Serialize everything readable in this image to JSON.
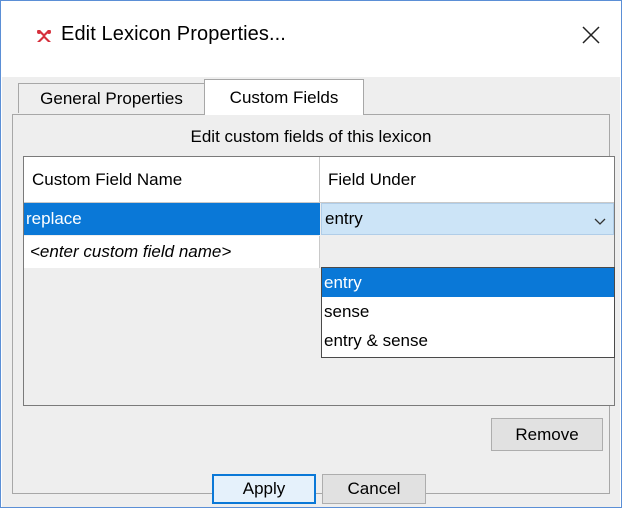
{
  "window": {
    "title": "Edit Lexicon Properties...",
    "app_icon": "lexicon-app-icon",
    "close_icon": "close-icon"
  },
  "tabs": [
    {
      "label": "General Properties",
      "active": false
    },
    {
      "label": "Custom Fields",
      "active": true
    }
  ],
  "panel": {
    "header": "Edit custom fields of this lexicon"
  },
  "table": {
    "columns": [
      "Custom Field Name",
      "Field Under"
    ],
    "rows": [
      {
        "name": "replace",
        "field_under": "entry",
        "selected": true
      },
      {
        "name": "<enter custom field name>",
        "placeholder": true
      }
    ]
  },
  "dropdown": {
    "selected": "entry",
    "options": [
      "entry",
      "sense",
      "entry & sense"
    ]
  },
  "buttons": {
    "remove": "Remove",
    "apply": "Apply",
    "cancel": "Cancel"
  },
  "colors": {
    "selection": "#0a78d7",
    "dropdown_bg": "#cce4f7",
    "dialog_bg": "#eeeeee",
    "app_icon": "#d6303c"
  }
}
